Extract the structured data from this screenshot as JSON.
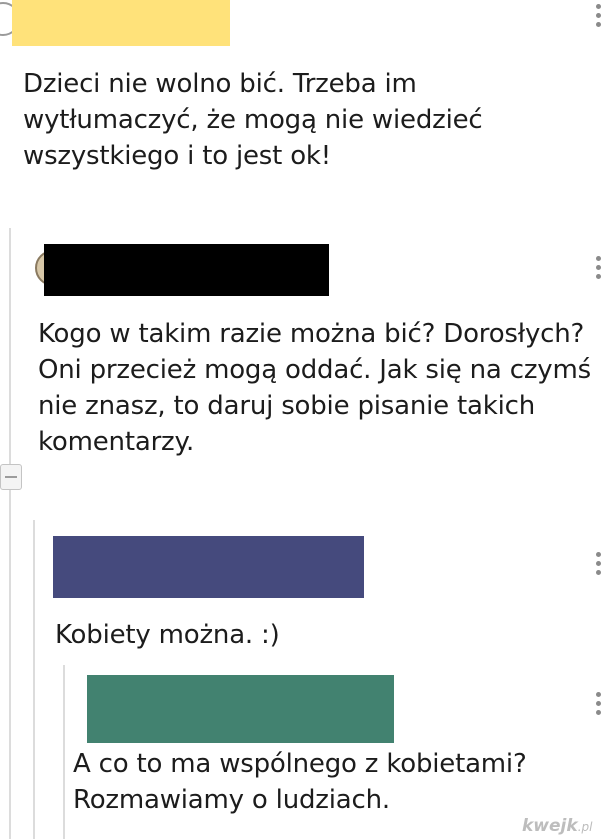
{
  "comments": {
    "top": {
      "author_redaction_color": "#ffe27a",
      "text": "Dzieci nie wolno bić. Trzeba im wytłumaczyć, że mogą nie wiedzieć wszystkiego i to jest ok!"
    },
    "reply1": {
      "author_redaction_color": "#000000",
      "text": "Kogo w takim razie można bić? Dorosłych? Oni przecież mogą oddać. Jak się na czymś nie znasz, to daruj sobie pisanie takich komentarzy."
    },
    "reply2": {
      "author_redaction_color": "#454a7d",
      "text": "Kobiety można. :)"
    },
    "reply3": {
      "author_redaction_color": "#428270",
      "text": "A co to ma wspólnego z kobietami? Rozmawiamy o ludziach."
    }
  },
  "icons": {
    "menu": "more-vertical-icon",
    "collapse": "collapse-thread-icon",
    "avatar": "user-avatar-icon"
  },
  "watermark": {
    "brand": "kwejk",
    "suffix": ".pl"
  }
}
